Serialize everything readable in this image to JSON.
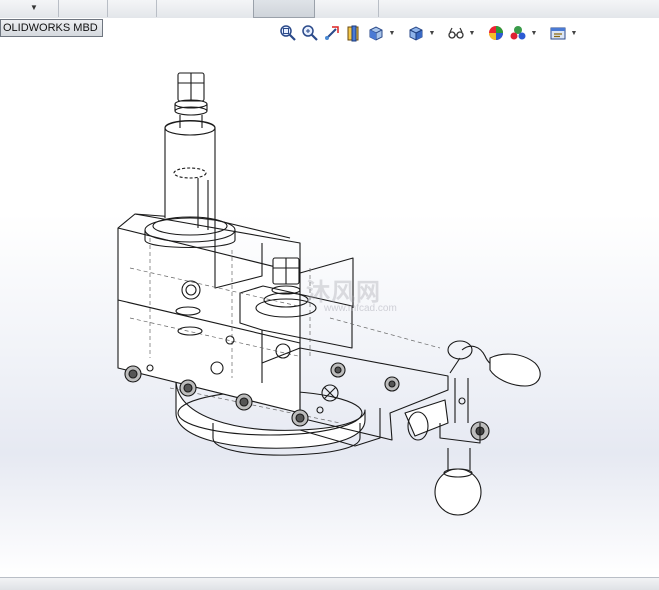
{
  "viewport_tab": {
    "label": "OLIDWORKS MBD"
  },
  "watermark": {
    "text": "沐风网",
    "url": "www.mfcad.com"
  },
  "hud_icons": [
    "zoom-to-fit-icon",
    "zoom-to-area-icon",
    "previous-view-icon",
    "section-view-icon",
    "view-orientation-icon",
    "display-style-icon",
    "hide-show-items-icon",
    "edit-appearance-icon",
    "apply-scene-icon",
    "view-settings-icon"
  ]
}
